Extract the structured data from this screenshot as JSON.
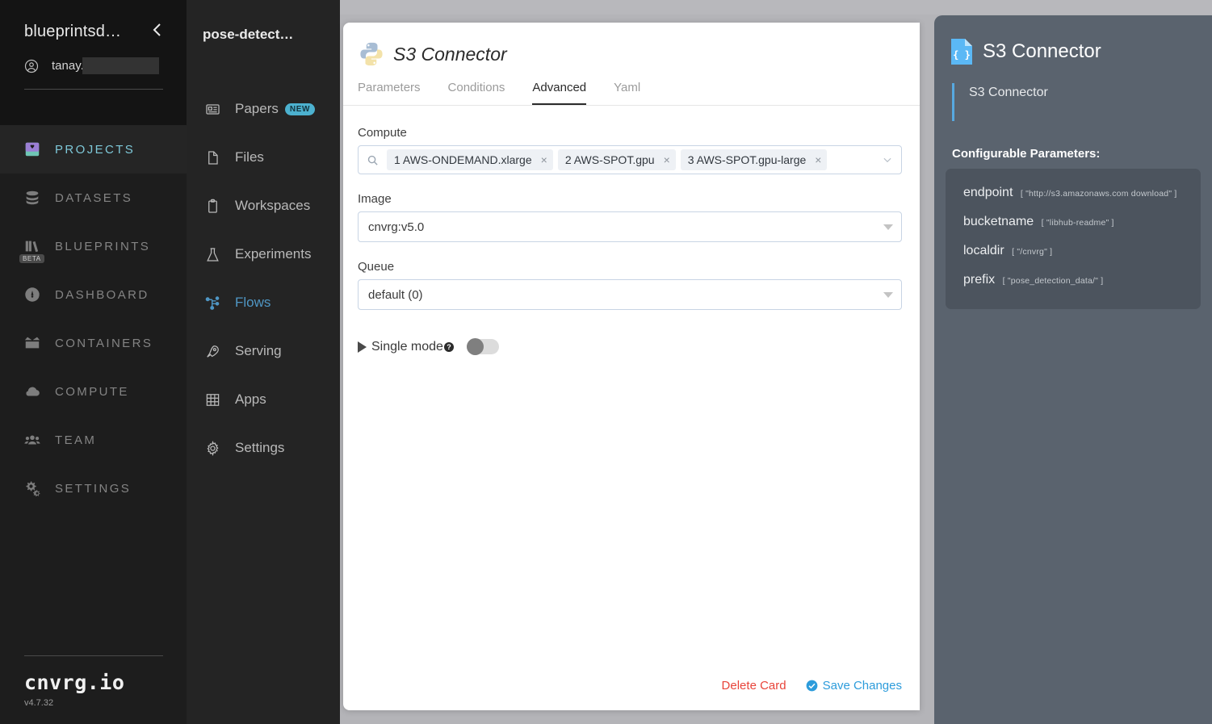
{
  "sidebar_primary": {
    "org_name": "blueprintsd…",
    "collapse_icon": "chevron-left-icon",
    "user_icon": "user-circle-icon",
    "user_name": "tanay.",
    "items": [
      {
        "label": "PROJECTS",
        "icon": "book-icon",
        "active": true,
        "badge": ""
      },
      {
        "label": "DATASETS",
        "icon": "database-icon",
        "active": false,
        "badge": ""
      },
      {
        "label": "BLUEPRINTS",
        "icon": "books-icon",
        "active": false,
        "badge": "BETA"
      },
      {
        "label": "DASHBOARD",
        "icon": "gauge-icon",
        "active": false,
        "badge": ""
      },
      {
        "label": "CONTAINERS",
        "icon": "box-icon",
        "active": false,
        "badge": ""
      },
      {
        "label": "COMPUTE",
        "icon": "cloud-icon",
        "active": false,
        "badge": ""
      },
      {
        "label": "TEAM",
        "icon": "people-icon",
        "active": false,
        "badge": ""
      },
      {
        "label": "SETTINGS",
        "icon": "gears-icon",
        "active": false,
        "badge": ""
      }
    ],
    "brand": "cnvrg.io",
    "version": "v4.7.32"
  },
  "sidebar_secondary": {
    "project_title": "pose-detect…",
    "items": [
      {
        "label": "Papers",
        "icon": "article-icon",
        "active": false,
        "badge": "NEW"
      },
      {
        "label": "Files",
        "icon": "file-icon",
        "active": false,
        "badge": ""
      },
      {
        "label": "Workspaces",
        "icon": "clipboard-icon",
        "active": false,
        "badge": ""
      },
      {
        "label": "Experiments",
        "icon": "flask-icon",
        "active": false,
        "badge": ""
      },
      {
        "label": "Flows",
        "icon": "flow-icon",
        "active": true,
        "badge": ""
      },
      {
        "label": "Serving",
        "icon": "rocket-icon",
        "active": false,
        "badge": ""
      },
      {
        "label": "Apps",
        "icon": "grid-icon",
        "active": false,
        "badge": ""
      },
      {
        "label": "Settings",
        "icon": "gear-icon",
        "active": false,
        "badge": ""
      }
    ]
  },
  "card": {
    "icon": "python-logo-icon",
    "title": "S3 Connector",
    "tabs": [
      {
        "label": "Parameters",
        "active": false
      },
      {
        "label": "Conditions",
        "active": false
      },
      {
        "label": "Advanced",
        "active": true
      },
      {
        "label": "Yaml",
        "active": false
      }
    ],
    "compute": {
      "label": "Compute",
      "search_icon": "search-icon",
      "chevron_icon": "chevron-down-icon",
      "chips": [
        {
          "label": "1 AWS-ONDEMAND.xlarge",
          "remove": "×"
        },
        {
          "label": "2 AWS-SPOT.gpu",
          "remove": "×"
        },
        {
          "label": "3 AWS-SPOT.gpu-large",
          "remove": "×"
        }
      ]
    },
    "image": {
      "label": "Image",
      "value": "cnvrg:v5.0",
      "caret_icon": "caret-down-icon"
    },
    "queue": {
      "label": "Queue",
      "value": "default (0)",
      "caret_icon": "caret-down-icon"
    },
    "single_mode": {
      "play_icon": "play-triangle-icon",
      "label": "Single mode",
      "help_icon": "help-question-icon",
      "help_glyph": "?",
      "enabled": false
    },
    "footer": {
      "delete_label": "Delete Card",
      "save_label": "Save Changes",
      "save_icon": "check-circle-icon"
    }
  },
  "info_panel": {
    "icon": "json-file-icon",
    "title": "S3 Connector",
    "description": "S3 Connector",
    "params_heading": "Configurable Parameters:",
    "parameters": [
      {
        "key": "endpoint",
        "value": "[ \"http://s3.amazonaws.com download\" ]"
      },
      {
        "key": "bucketname",
        "value": "[ \"libhub-readme\" ]"
      },
      {
        "key": "localdir",
        "value": "[ \"/cnvrg\" ]"
      },
      {
        "key": "prefix",
        "value": "[ \"pose_detection_data/\" ]"
      }
    ]
  },
  "colors": {
    "accent_blue": "#2d9cdb",
    "danger_red": "#e8443a",
    "sidebar_active": "#7ec8d8",
    "flows_active": "#4f96c4",
    "badge_new": "#4cb1cf",
    "panel_bg": "#5a636e",
    "quote_bar": "#57a9e0"
  }
}
